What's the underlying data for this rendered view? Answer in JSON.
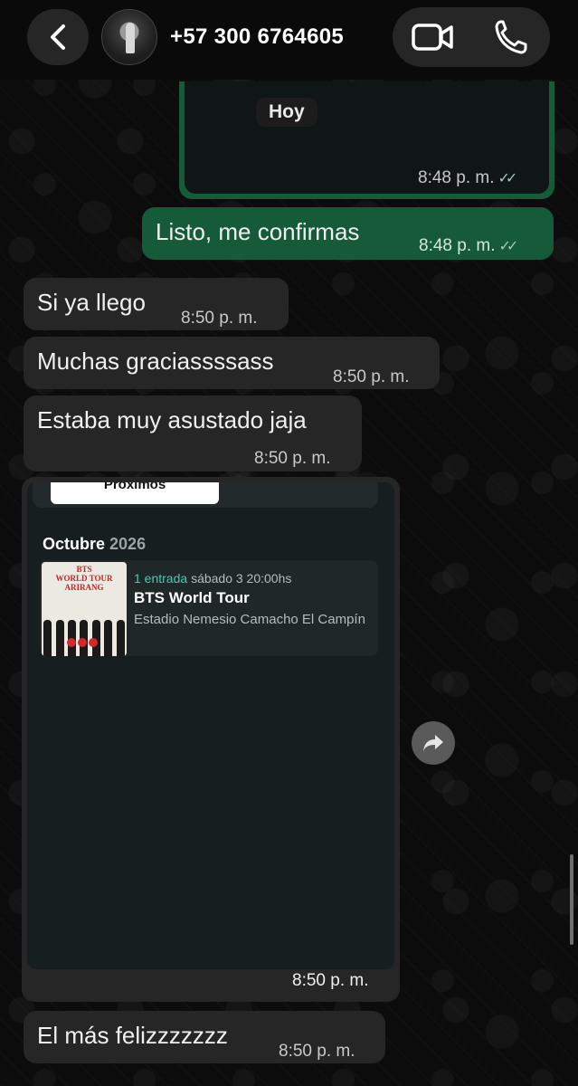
{
  "header": {
    "contact_name": "+57 300 6764605"
  },
  "date_chip": "Hoy",
  "previous_message": {
    "time": "8:48 p. m.",
    "ticks": "✓✓"
  },
  "messages": [
    {
      "text": "Listo, me confirmas",
      "time": "8:48 p. m.",
      "ticks": "✓✓",
      "direction": "outgoing"
    },
    {
      "text": "Si ya llego",
      "time": "8:50 p. m.",
      "direction": "incoming"
    },
    {
      "text": "Muchas graciassssass",
      "time": "8:50 p. m.",
      "direction": "incoming"
    },
    {
      "text": "Estaba muy asustado jaja",
      "time": "8:50 p. m.",
      "direction": "incoming"
    },
    {
      "text": "El más felizzzzzzz",
      "time": "8:50 p. m.",
      "direction": "incoming"
    }
  ],
  "shared_card": {
    "tab_label": "Próximos",
    "month": "Octubre",
    "year": "2026",
    "event": {
      "quantity": "1 entrada",
      "datetime": "sábado 3 20:00hs",
      "name": "BTS World Tour",
      "venue": "Estadio Nemesio Camacho El Campín",
      "poster_text": "BTS WORLD TOUR ARIRANG"
    },
    "time": "8:50 p. m."
  },
  "colors": {
    "outgoing_bubble": "#155b3a",
    "incoming_bubble": "#262626",
    "accent_teal": "#3ecfb0"
  }
}
